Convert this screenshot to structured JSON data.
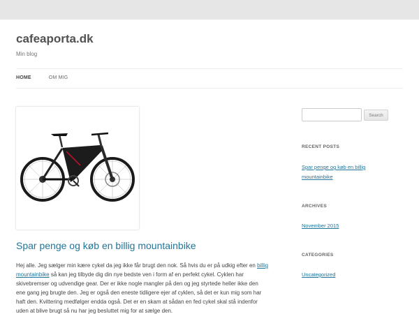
{
  "site": {
    "title": "cafeaporta.dk",
    "description": "Min blog"
  },
  "nav": {
    "items": [
      {
        "label": "HOME",
        "active": true
      },
      {
        "label": "OM MIG",
        "active": false
      }
    ]
  },
  "post": {
    "title": "Spar penge og køb en billig mountainbike",
    "body_intro": "Hej alle. Jeg sælger min kære cykel da jeg ikke får brugt den nok. Så hvis du er på udkig efter en",
    "body_link": "billig mountainbike",
    "body_rest": "så kan jeg tilbyde dig din nye bedste ven i form af en perfekt cykel. Cyklen har skivebremser og udvendige gear. Der er ikke nogle mangler på den og jeg styrtede heller ikke den ene gang jeg brugte den. Jeg er også den eneste tidligere ejer af cyklen, så det er kun mig som har haft den. Kvittering medfølger endda også. Det er en skam at sådan en fed cykel skal stå indenfor uden at blive brugt så nu har jeg besluttet mig for at sælge den.",
    "image_icon": "mountain-bike-image"
  },
  "sidebar": {
    "search": {
      "placeholder": "",
      "button_label": "Search"
    },
    "recent_posts": {
      "title": "RECENT POSTS",
      "items": [
        "Spar penge og køb en billig mountainbike"
      ]
    },
    "archives": {
      "title": "ARCHIVES",
      "items": [
        "November 2015"
      ]
    },
    "categories": {
      "title": "CATEGORIES",
      "items": [
        "Uncategorized"
      ]
    }
  },
  "colors": {
    "link": "#21759b",
    "background": "#e6e6e6",
    "page": "#ffffff"
  }
}
